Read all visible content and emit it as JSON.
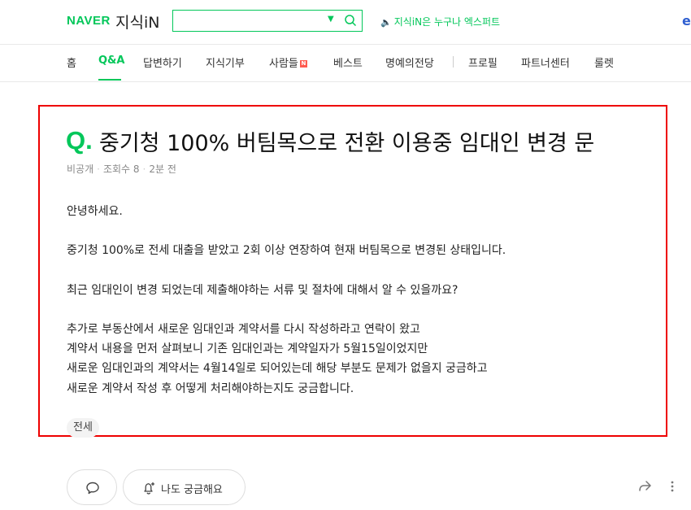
{
  "header": {
    "logo_naver": "NAVER",
    "logo_kin": "지식iN",
    "search": {
      "value": "",
      "placeholder": ""
    },
    "promo": "지식iN은 누구나 엑스퍼트"
  },
  "nav": {
    "items": [
      {
        "label": "홈"
      },
      {
        "label": "Q&A",
        "active": true
      },
      {
        "label": "답변하기"
      },
      {
        "label": "지식기부"
      },
      {
        "label": "사람들",
        "badge": "N"
      },
      {
        "label": "베스트"
      },
      {
        "label": "명예의전당"
      },
      {
        "label": "프로필"
      },
      {
        "label": "파트너센터"
      },
      {
        "label": "룰렛"
      }
    ]
  },
  "question": {
    "q_mark": "Q.",
    "title": "중기청 100% 버팀목으로 전환 이용중 임대인 변경 문",
    "meta": {
      "visibility": "비공개",
      "views": "조회수 8",
      "time": "2분 전"
    },
    "body": [
      "안녕하세요.",
      "중기청 100%로 전세 대출을 받았고 2회 이상 연장하여 현재 버팀목으로 변경된 상태입니다.",
      "최근 임대인이 변경 되었는데 제출해야하는 서류 및 절차에 대해서 알 수 있을까요?",
      "추가로 부동산에서 새로운 임대인과 계약서를 다시 작성하라고 연락이 왔고",
      "계약서 내용을 먼저 살펴보니 기존 임대인과는 계약일자가 5월15일이었지만",
      "새로운 임대인과의 계약서는 4월14일로 되어있는데 해당 부분도 문제가 없을지 궁금하고",
      "새로운 계약서 작성 후 어떻게 처리해야하는지도 궁금합니다."
    ],
    "tag": "전세"
  },
  "actions": {
    "curious_label": "나도 궁금해요"
  },
  "colors": {
    "accent": "#03c75a",
    "highlight_frame": "#e00000"
  }
}
